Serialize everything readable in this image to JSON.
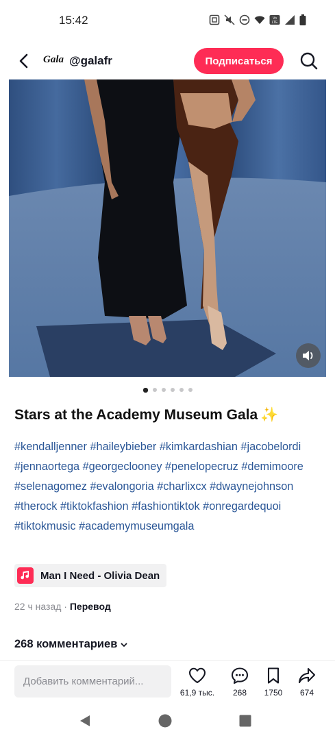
{
  "status_bar": {
    "time": "15:42",
    "icons": [
      "nfc-icon",
      "mute-icon",
      "dnd-icon",
      "wifi-icon",
      "volte-icon",
      "signal-icon",
      "battery-icon"
    ]
  },
  "header": {
    "brand_logo": "Gala",
    "username": "@galafr",
    "follow_label": "Подписаться"
  },
  "media": {
    "carousel": {
      "total": 6,
      "active_index": 0
    }
  },
  "post": {
    "title": "Stars at the Academy Museum Gala",
    "title_emoji": "✨",
    "hashtags": [
      "#kendalljenner",
      "#haileybieber",
      "#kimkardashian",
      "#jacobelordi",
      "#jennaortega",
      "#georgeclooney",
      "#penelopecruz",
      "#demimoore",
      "#selenagomez",
      "#evalongoria",
      "#charlixcx",
      "#dwaynejohnson",
      "#therock",
      "#tiktokfashion",
      "#fashiontiktok",
      "#onregardequoi",
      "#tiktokmusic",
      "#academymuseumgala"
    ],
    "music": "Man I Need - Olivia Dean",
    "time_ago": "22 ч назад",
    "separator": " · ",
    "translate_label": "Перевод",
    "comments_count_label": "268 комментариев"
  },
  "actions": {
    "comment_placeholder": "Добавить комментарий...",
    "likes": "61,9 тыс.",
    "comments": "268",
    "saves": "1750",
    "shares": "674"
  },
  "colors": {
    "accent": "#fe2c55",
    "hashtag": "#2b5797",
    "muted_text": "#8a8b91"
  }
}
